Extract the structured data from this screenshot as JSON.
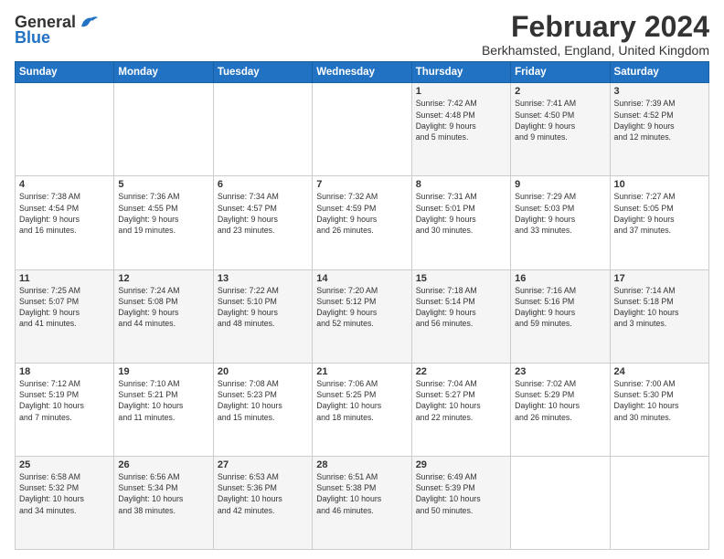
{
  "logo": {
    "general": "General",
    "blue": "Blue"
  },
  "header": {
    "month": "February 2024",
    "location": "Berkhamsted, England, United Kingdom"
  },
  "days_of_week": [
    "Sunday",
    "Monday",
    "Tuesday",
    "Wednesday",
    "Thursday",
    "Friday",
    "Saturday"
  ],
  "weeks": [
    [
      {
        "day": "",
        "info": ""
      },
      {
        "day": "",
        "info": ""
      },
      {
        "day": "",
        "info": ""
      },
      {
        "day": "",
        "info": ""
      },
      {
        "day": "1",
        "info": "Sunrise: 7:42 AM\nSunset: 4:48 PM\nDaylight: 9 hours\nand 5 minutes."
      },
      {
        "day": "2",
        "info": "Sunrise: 7:41 AM\nSunset: 4:50 PM\nDaylight: 9 hours\nand 9 minutes."
      },
      {
        "day": "3",
        "info": "Sunrise: 7:39 AM\nSunset: 4:52 PM\nDaylight: 9 hours\nand 12 minutes."
      }
    ],
    [
      {
        "day": "4",
        "info": "Sunrise: 7:38 AM\nSunset: 4:54 PM\nDaylight: 9 hours\nand 16 minutes."
      },
      {
        "day": "5",
        "info": "Sunrise: 7:36 AM\nSunset: 4:55 PM\nDaylight: 9 hours\nand 19 minutes."
      },
      {
        "day": "6",
        "info": "Sunrise: 7:34 AM\nSunset: 4:57 PM\nDaylight: 9 hours\nand 23 minutes."
      },
      {
        "day": "7",
        "info": "Sunrise: 7:32 AM\nSunset: 4:59 PM\nDaylight: 9 hours\nand 26 minutes."
      },
      {
        "day": "8",
        "info": "Sunrise: 7:31 AM\nSunset: 5:01 PM\nDaylight: 9 hours\nand 30 minutes."
      },
      {
        "day": "9",
        "info": "Sunrise: 7:29 AM\nSunset: 5:03 PM\nDaylight: 9 hours\nand 33 minutes."
      },
      {
        "day": "10",
        "info": "Sunrise: 7:27 AM\nSunset: 5:05 PM\nDaylight: 9 hours\nand 37 minutes."
      }
    ],
    [
      {
        "day": "11",
        "info": "Sunrise: 7:25 AM\nSunset: 5:07 PM\nDaylight: 9 hours\nand 41 minutes."
      },
      {
        "day": "12",
        "info": "Sunrise: 7:24 AM\nSunset: 5:08 PM\nDaylight: 9 hours\nand 44 minutes."
      },
      {
        "day": "13",
        "info": "Sunrise: 7:22 AM\nSunset: 5:10 PM\nDaylight: 9 hours\nand 48 minutes."
      },
      {
        "day": "14",
        "info": "Sunrise: 7:20 AM\nSunset: 5:12 PM\nDaylight: 9 hours\nand 52 minutes."
      },
      {
        "day": "15",
        "info": "Sunrise: 7:18 AM\nSunset: 5:14 PM\nDaylight: 9 hours\nand 56 minutes."
      },
      {
        "day": "16",
        "info": "Sunrise: 7:16 AM\nSunset: 5:16 PM\nDaylight: 9 hours\nand 59 minutes."
      },
      {
        "day": "17",
        "info": "Sunrise: 7:14 AM\nSunset: 5:18 PM\nDaylight: 10 hours\nand 3 minutes."
      }
    ],
    [
      {
        "day": "18",
        "info": "Sunrise: 7:12 AM\nSunset: 5:19 PM\nDaylight: 10 hours\nand 7 minutes."
      },
      {
        "day": "19",
        "info": "Sunrise: 7:10 AM\nSunset: 5:21 PM\nDaylight: 10 hours\nand 11 minutes."
      },
      {
        "day": "20",
        "info": "Sunrise: 7:08 AM\nSunset: 5:23 PM\nDaylight: 10 hours\nand 15 minutes."
      },
      {
        "day": "21",
        "info": "Sunrise: 7:06 AM\nSunset: 5:25 PM\nDaylight: 10 hours\nand 18 minutes."
      },
      {
        "day": "22",
        "info": "Sunrise: 7:04 AM\nSunset: 5:27 PM\nDaylight: 10 hours\nand 22 minutes."
      },
      {
        "day": "23",
        "info": "Sunrise: 7:02 AM\nSunset: 5:29 PM\nDaylight: 10 hours\nand 26 minutes."
      },
      {
        "day": "24",
        "info": "Sunrise: 7:00 AM\nSunset: 5:30 PM\nDaylight: 10 hours\nand 30 minutes."
      }
    ],
    [
      {
        "day": "25",
        "info": "Sunrise: 6:58 AM\nSunset: 5:32 PM\nDaylight: 10 hours\nand 34 minutes."
      },
      {
        "day": "26",
        "info": "Sunrise: 6:56 AM\nSunset: 5:34 PM\nDaylight: 10 hours\nand 38 minutes."
      },
      {
        "day": "27",
        "info": "Sunrise: 6:53 AM\nSunset: 5:36 PM\nDaylight: 10 hours\nand 42 minutes."
      },
      {
        "day": "28",
        "info": "Sunrise: 6:51 AM\nSunset: 5:38 PM\nDaylight: 10 hours\nand 46 minutes."
      },
      {
        "day": "29",
        "info": "Sunrise: 6:49 AM\nSunset: 5:39 PM\nDaylight: 10 hours\nand 50 minutes."
      },
      {
        "day": "",
        "info": ""
      },
      {
        "day": "",
        "info": ""
      }
    ]
  ]
}
